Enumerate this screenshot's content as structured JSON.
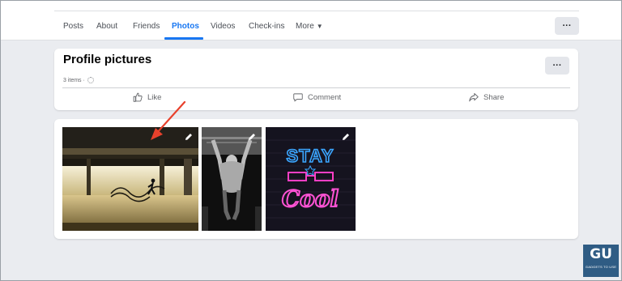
{
  "nav": {
    "tabs": [
      {
        "label": "Posts"
      },
      {
        "label": "About"
      },
      {
        "label": "Friends"
      },
      {
        "label": "Photos",
        "active": true
      },
      {
        "label": "Videos"
      },
      {
        "label": "Check-ins"
      },
      {
        "label": "More"
      }
    ],
    "more_caret": "▼",
    "menu_dots": "···"
  },
  "album": {
    "title": "Profile pictures",
    "meta": "3 items ·",
    "menu_dots": "···",
    "actions": {
      "like": "Like",
      "comment": "Comment",
      "share": "Share"
    }
  },
  "photos": [
    {
      "name": "gym-warehouse-battle-ropes",
      "editable": true
    },
    {
      "name": "bodybuilder-pullup",
      "editable": true
    },
    {
      "name": "stay-cool-neon",
      "editable": true,
      "text_top": "STAY",
      "text_bottom": "Cool"
    }
  ],
  "watermark": {
    "logo": "GU",
    "caption": "GADGETS TO USE"
  },
  "colors": {
    "accent": "#1877f2",
    "page_bg": "#eaecf0",
    "arrow": "#e8412c"
  }
}
